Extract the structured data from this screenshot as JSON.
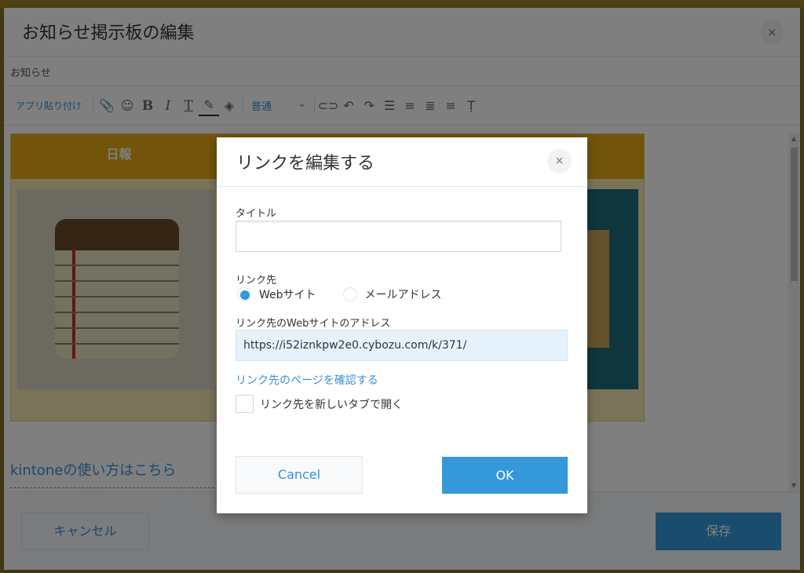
{
  "outer_dialog": {
    "title": "お知らせ掲示板の編集",
    "close_glyph": "×",
    "subject": "お知らせ",
    "toolbar": {
      "paste_app_label": "アプリ貼り付け",
      "font_size_label": "普通",
      "icons": [
        "paperclip-icon",
        "emoji-icon",
        "bold-icon",
        "italic-icon",
        "underline-icon",
        "text-color-icon",
        "background-color-icon",
        "link-icon",
        "undo-icon",
        "redo-icon",
        "bulleted-list-icon",
        "numbered-list-icon",
        "align-left-icon",
        "align-center-icon",
        "clear-format-icon"
      ]
    },
    "content": {
      "banner_heading": "日報",
      "link_text": "kintoneの使い方はこちら"
    },
    "footer": {
      "cancel_label": "キャンセル",
      "save_label": "保存"
    }
  },
  "link_dialog": {
    "title": "リンクを編集する",
    "close_glyph": "×",
    "title_label": "タイトル",
    "title_value": "",
    "destination_label": "リンク先",
    "options": [
      {
        "label": "Webサイト",
        "selected": true
      },
      {
        "label": "メールアドレス",
        "selected": false
      }
    ],
    "url_label": "リンク先のWebサイトのアドレス",
    "url_value": "https://i52iznkpw2e0.cybozu.com/k/371/",
    "check_page_link": "リンク先のページを確認する",
    "new_tab_label": "リンク先を新しいタブで開く",
    "new_tab_checked": false,
    "cancel_label": "Cancel",
    "ok_label": "OK"
  },
  "colors": {
    "accent": "#3498db",
    "link": "#3a8fd8",
    "banner_header": "#e6a817"
  }
}
